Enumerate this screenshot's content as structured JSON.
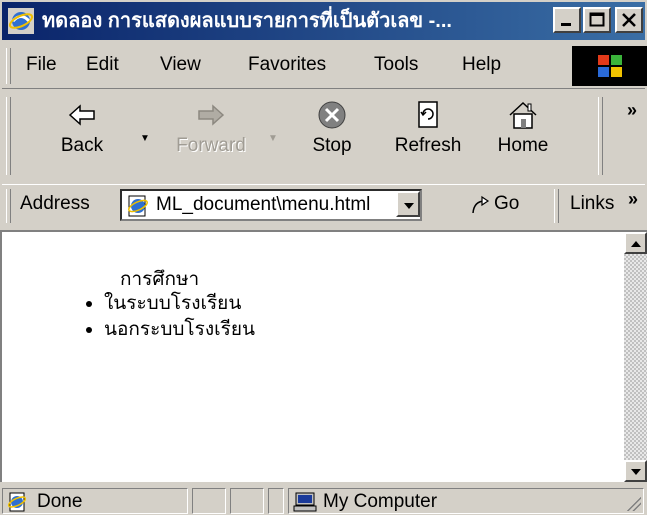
{
  "window": {
    "title": "ทดลอง การแสดงผลแบบรายการที่เป็นตัวเลข -..."
  },
  "menu": {
    "items": [
      "File",
      "Edit",
      "View",
      "Favorites",
      "Tools",
      "Help"
    ]
  },
  "toolbar": {
    "back": "Back",
    "forward": "Forward",
    "stop": "Stop",
    "refresh": "Refresh",
    "home": "Home",
    "more": "»"
  },
  "address": {
    "label": "Address",
    "value": "ML_document\\menu.html",
    "go": "Go",
    "links": "Links",
    "links_more": "»"
  },
  "content": {
    "heading": "การศึกษา",
    "items": [
      "ในระบบโรงเรียน",
      "นอกระบบโรงเรียน"
    ]
  },
  "status": {
    "text": "Done",
    "zone": "My Computer"
  },
  "colors": {
    "titlebar_start": "#0a246a",
    "titlebar_end": "#3a6ea5",
    "chrome": "#d4d0c8"
  }
}
